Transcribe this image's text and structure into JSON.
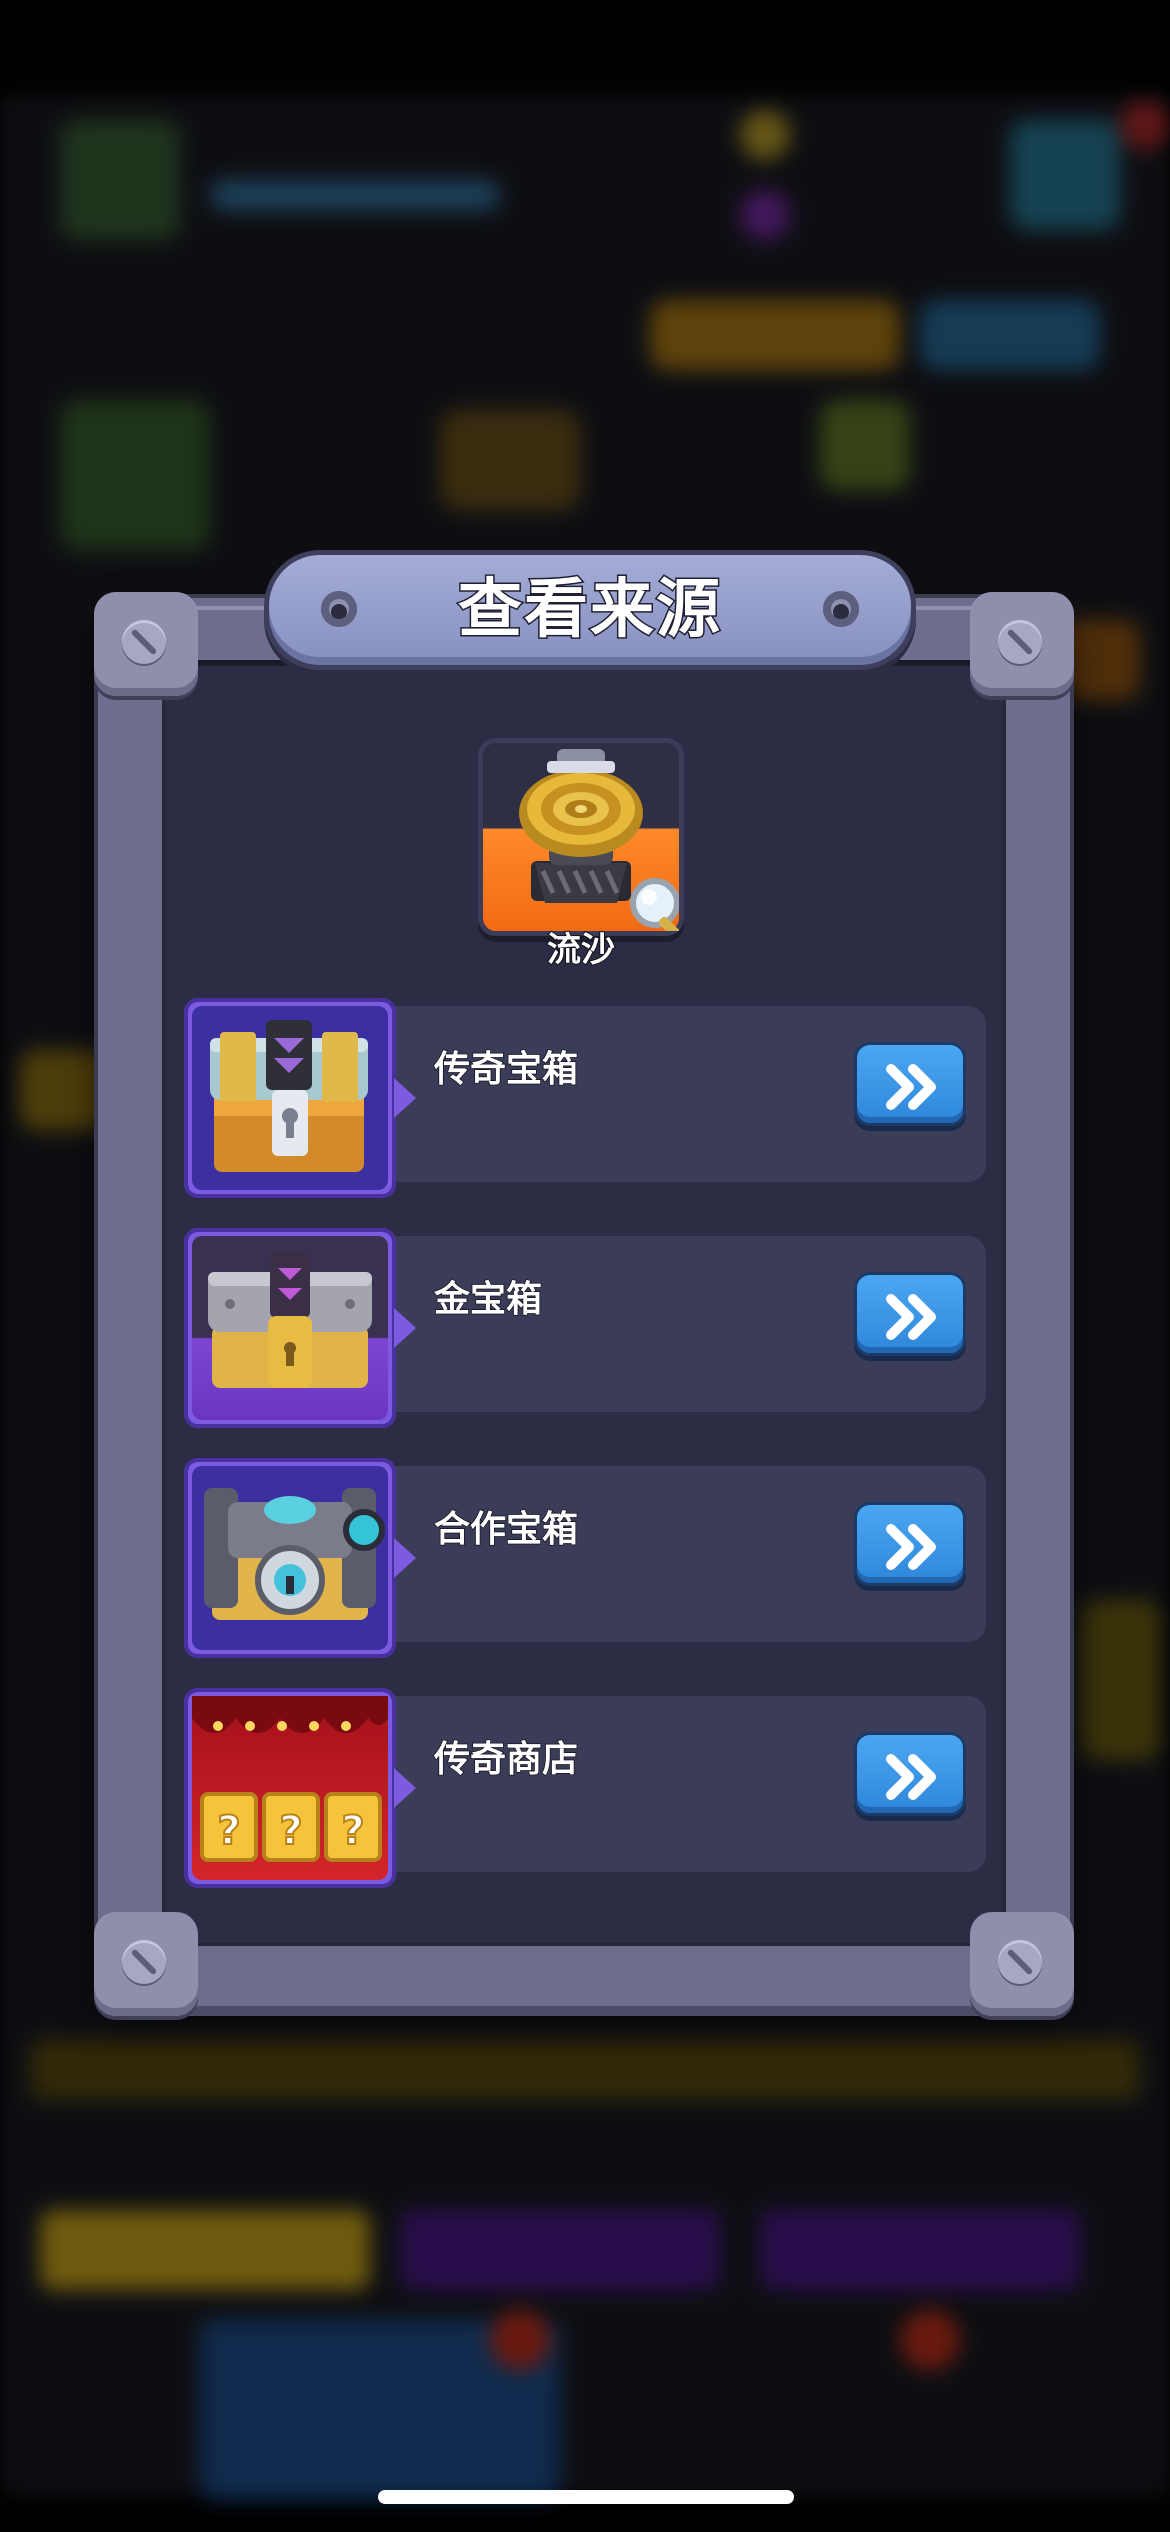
{
  "dialog": {
    "title": "查看来源",
    "item": {
      "name": "流沙",
      "icon": "quicksand-trap-icon"
    },
    "sources": [
      {
        "label": "传奇宝箱",
        "icon": "legendary-chest-icon",
        "color": "#5a4fd6"
      },
      {
        "label": "金宝箱",
        "icon": "gold-chest-icon",
        "color": "#7b4bd0"
      },
      {
        "label": "合作宝箱",
        "icon": "coop-chest-icon",
        "color": "#5a4fd6"
      },
      {
        "label": "传奇商店",
        "icon": "legendary-shop-icon",
        "color": "#c0121a"
      }
    ]
  },
  "colors": {
    "accent_blue": "#2f86da",
    "panel": "#2c2d44",
    "frame": "#6d6e8d"
  }
}
